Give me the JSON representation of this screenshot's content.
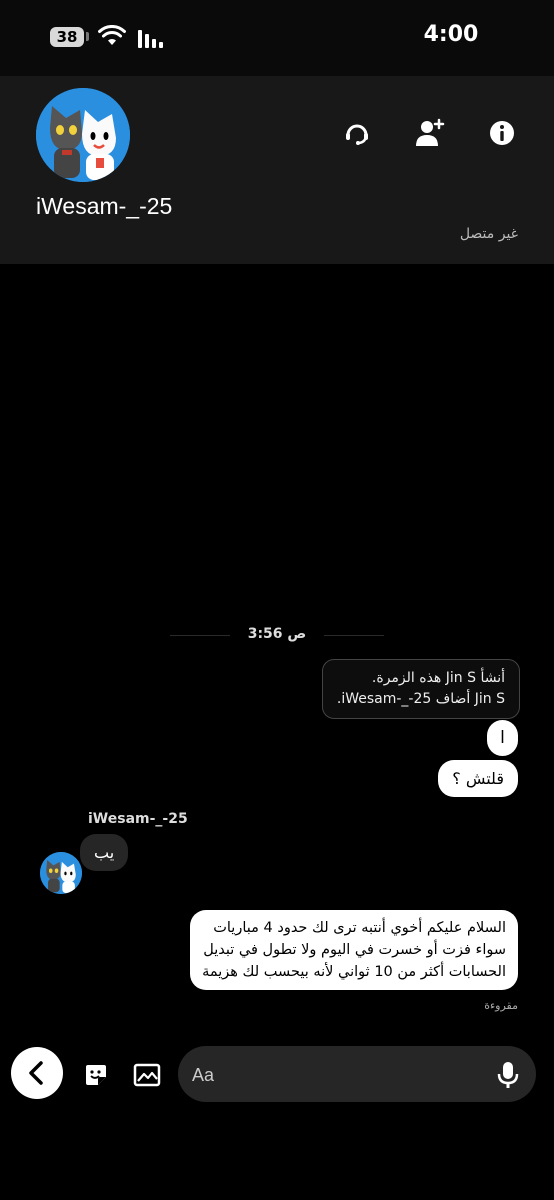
{
  "status_bar": {
    "battery": "38",
    "time": "4:00"
  },
  "header": {
    "name": "iWesam-_-25",
    "status": "غير متصل"
  },
  "chat": {
    "timestamp": "3:56 ص",
    "system_lines": [
      "أنشأ Jin S هذه الزمرة.",
      "Jin S أضاف iWesam-_-25."
    ],
    "messages": {
      "out1": "ا",
      "out2": "قلتش ؟",
      "sender": "iWesam-_-25",
      "in1": "يب",
      "out3_lines": [
        "السلام عليكم أخوي أنتبه ترى لك حدود 4 مباريات",
        "سواء فزت أو خسرت في اليوم  ولا تطول في تبديل",
        "الحسابات أكثر من 10 ثواني لأنه بيحسب لك هزيمة"
      ]
    },
    "read_receipt": "مقروءة"
  },
  "composer": {
    "placeholder": "Aa"
  },
  "icons": {
    "back": "chevron-left-icon",
    "sticker": "sticker-icon",
    "gallery": "image-icon",
    "mic": "microphone-icon",
    "headset": "headset-icon",
    "add_user": "add-user-icon",
    "info": "info-icon"
  }
}
